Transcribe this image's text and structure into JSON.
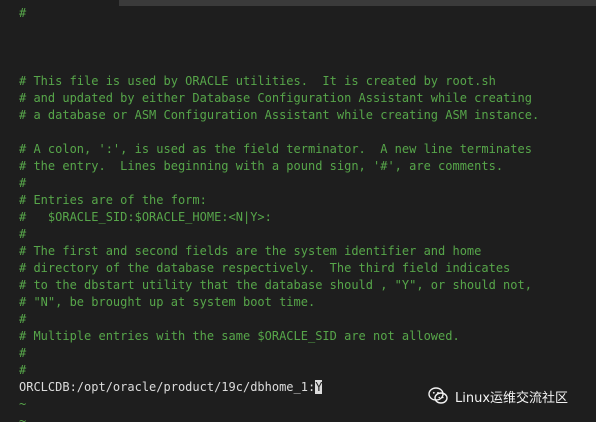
{
  "editor": {
    "lines": [
      "#",
      "",
      "",
      "",
      "# This file is used by ORACLE utilities.  It is created by root.sh",
      "# and updated by either Database Configuration Assistant while creating",
      "# a database or ASM Configuration Assistant while creating ASM instance.",
      "",
      "# A colon, ':', is used as the field terminator.  A new line terminates",
      "# the entry.  Lines beginning with a pound sign, '#', are comments.",
      "#",
      "# Entries are of the form:",
      "#   $ORACLE_SID:$ORACLE_HOME:<N|Y>:",
      "#",
      "# The first and second fields are the system identifier and home",
      "# directory of the database respectively.  The third field indicates",
      "# to the dbstart utility that the database should , \"Y\", or should not,",
      "# \"N\", be brought up at system boot time.",
      "#",
      "# Multiple entries with the same $ORACLE_SID are not allowed.",
      "#",
      "#"
    ],
    "entry_line_text": "ORCLCDB:/opt/oracle/product/19c/dbhome_1:",
    "cursor_char": "Y",
    "tilde": "~",
    "colors": {
      "background": "#1e1e1e",
      "comment": "#57a64a",
      "text": "#dcdcdc"
    }
  },
  "watermark": {
    "icon": "wechat-icon",
    "text": "Linux运维交流社区"
  }
}
